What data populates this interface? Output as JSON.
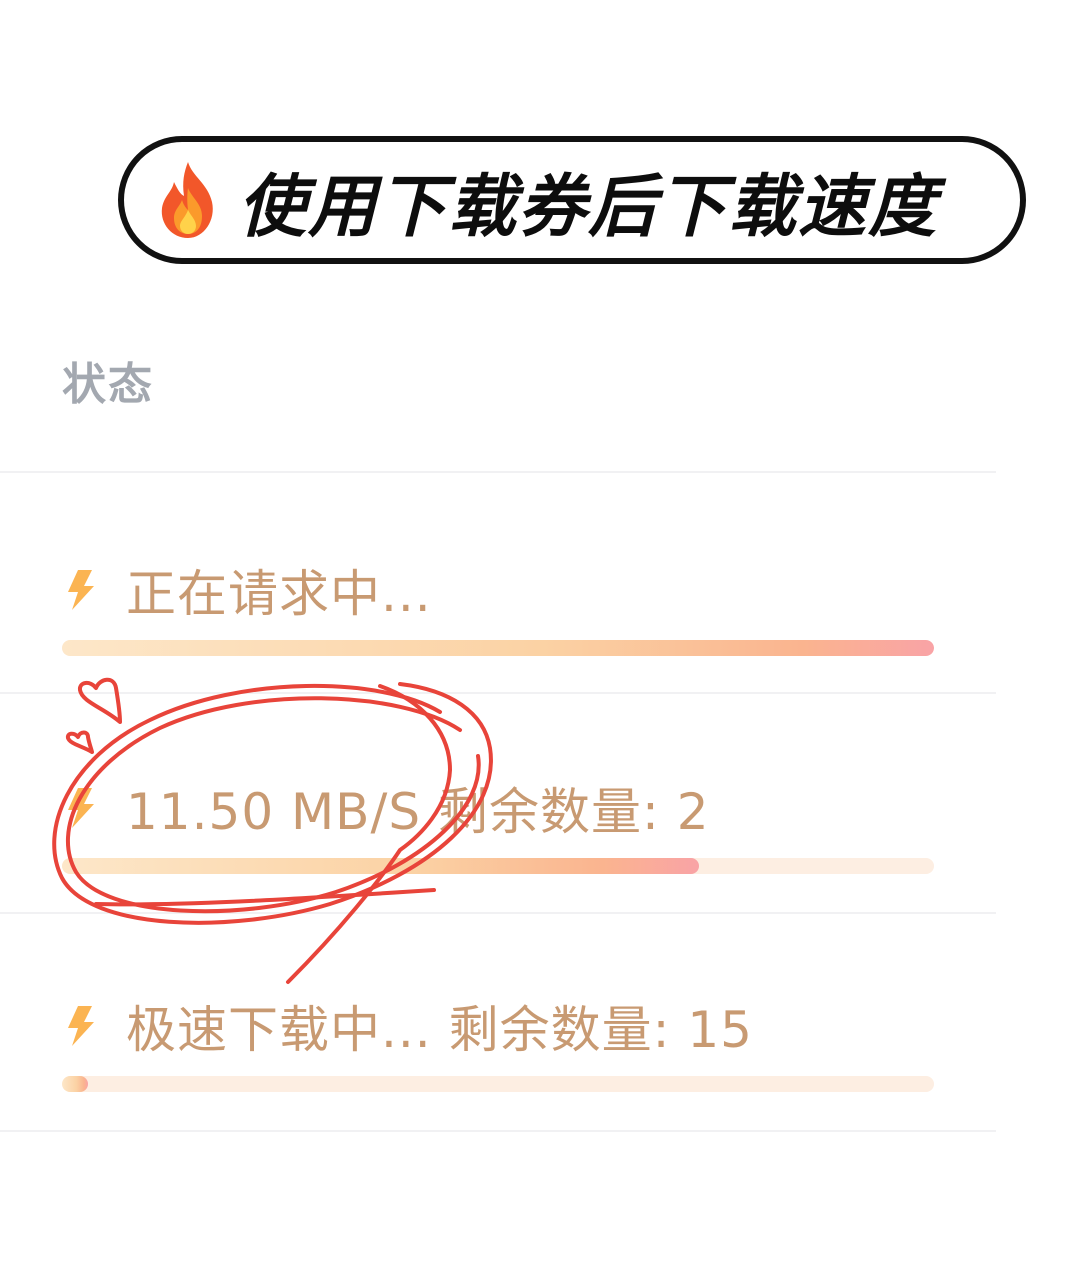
{
  "banner": {
    "icon": "flame-icon",
    "title": "使用下载券后下载速度"
  },
  "table": {
    "column_header": "状态",
    "rows": [
      {
        "icon": "lightning-bolt-icon",
        "label": "正在请求中...",
        "progress": 1.0
      },
      {
        "icon": "lightning-bolt-icon",
        "label": "11.50 MB/S 剩余数量: 2",
        "progress": 0.73
      },
      {
        "icon": "lightning-bolt-icon",
        "label": "极速下载中... 剩余数量: 15",
        "progress": 0.03
      }
    ]
  },
  "annotation": {
    "icon": "heart-doodle-icon",
    "color": "#e8443a"
  },
  "colors": {
    "label_text": "#c89a72",
    "header_text": "#a3a8b0",
    "track": "#fdeee2",
    "fill_start": "#fde7c9",
    "fill_end": "#f9a3a6"
  }
}
